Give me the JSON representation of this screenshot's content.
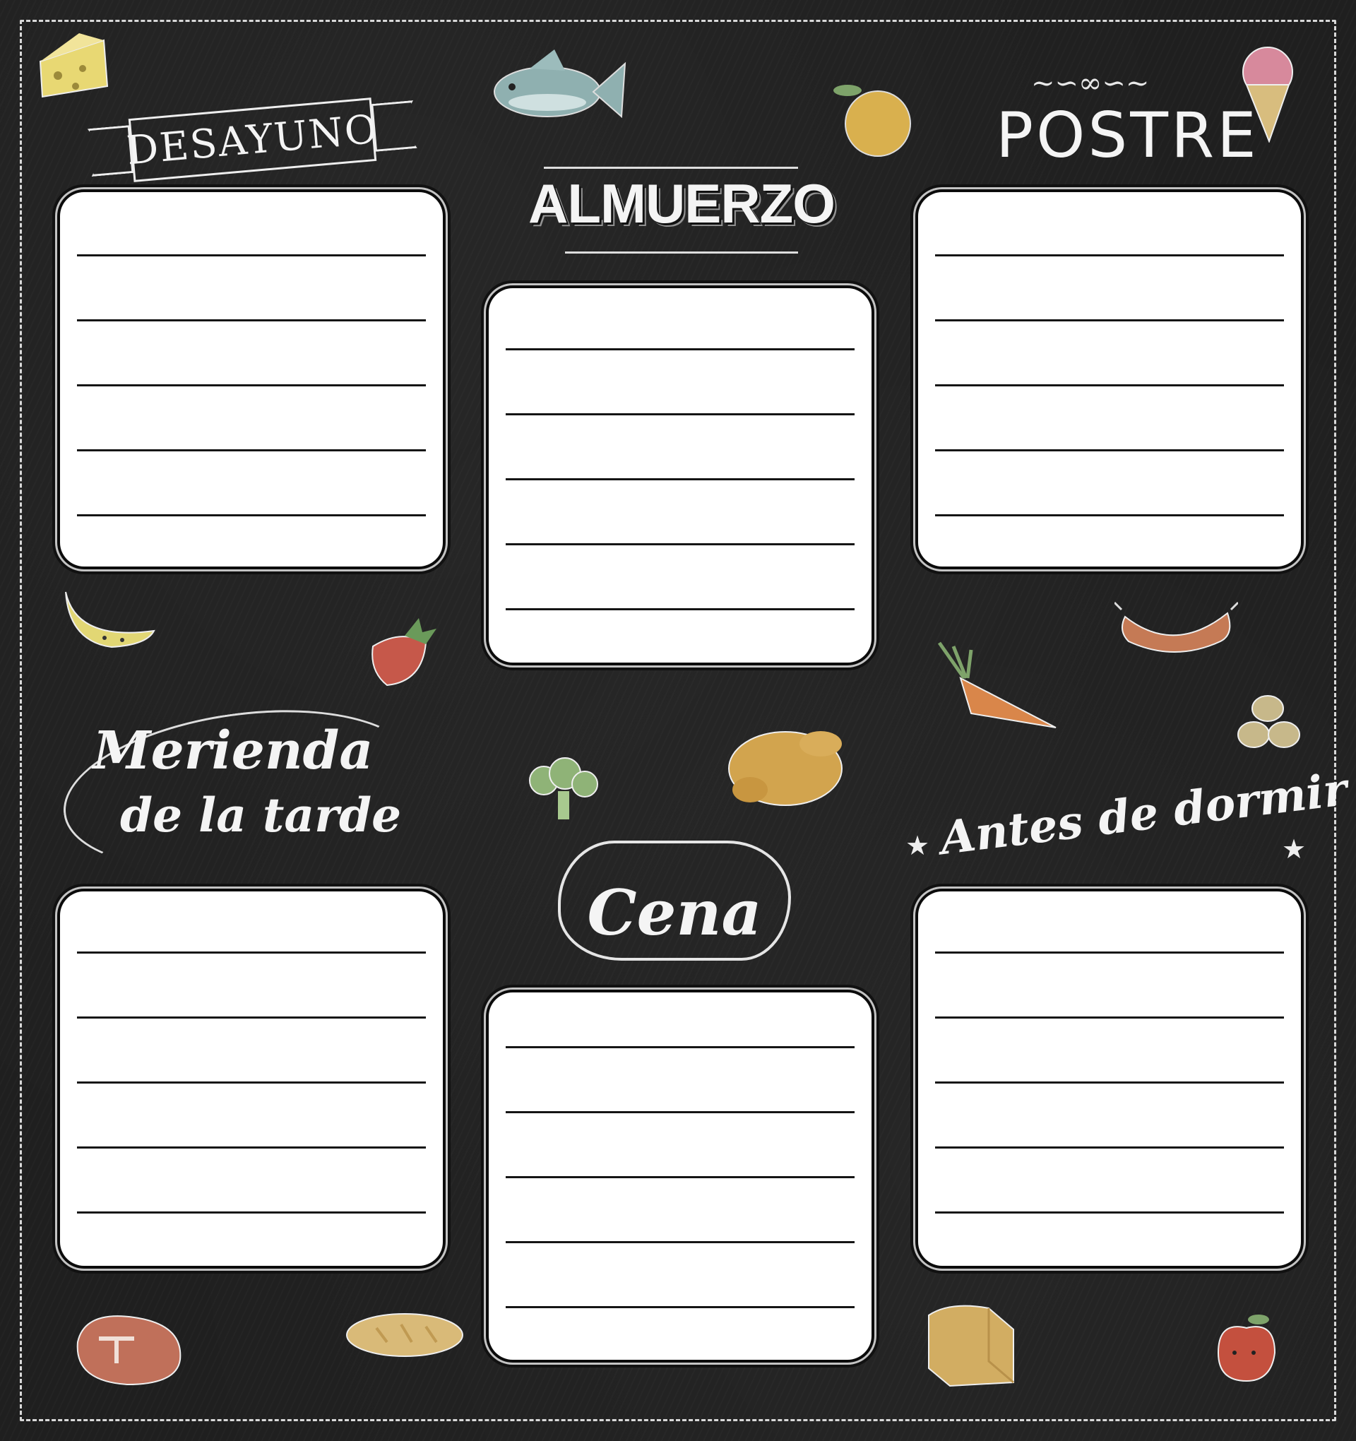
{
  "sections": {
    "desayuno": "DESAYUNO",
    "almuerzo": "ALMUERZO",
    "postre": "POSTRE",
    "merienda_line1": "Merienda",
    "merienda_line2": "de la tarde",
    "cena": "Cena",
    "antes": "Antes de dormir"
  },
  "colors": {
    "board": "#1f1f1f",
    "chalk": "#f4f4f4",
    "card": "#ffffff"
  },
  "icons": [
    "cheese-icon",
    "fish-icon",
    "orange-icon",
    "ice-cream-icon",
    "banana-icon",
    "strawberry-icon",
    "carrot-icon",
    "sausage-icon",
    "potatoes-icon",
    "chicken-icon",
    "broccoli-icon",
    "steak-icon",
    "baguette-icon",
    "bread-loaf-icon",
    "apple-icon"
  ]
}
